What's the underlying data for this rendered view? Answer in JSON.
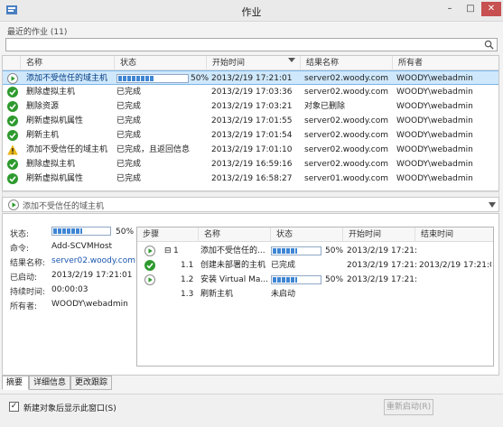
{
  "window": {
    "title": "作业",
    "min": "–",
    "max": "□",
    "close": "✕"
  },
  "recent_jobs": {
    "label": "最近的作业 (11)"
  },
  "search": {
    "placeholder": ""
  },
  "grid": {
    "columns": [
      "名称",
      "状态",
      "开始时间",
      "结果名称",
      "所有者"
    ],
    "rows": [
      {
        "icon": "running-play-icon",
        "name": "添加不受信任的域主机",
        "status": "",
        "progress": 50,
        "progress_label": "50%",
        "start": "2013/2/19 17:21:01",
        "result": "server02.woody.com",
        "owner": "WOODY\\webadmin",
        "selected": true
      },
      {
        "icon": "check-icon",
        "name": "删除虚拟主机",
        "status": "已完成",
        "start": "2013/2/19 17:03:36",
        "result": "server02.woody.com",
        "owner": "WOODY\\webadmin"
      },
      {
        "icon": "check-icon",
        "name": "删除资源",
        "status": "已完成",
        "start": "2013/2/19 17:03:21",
        "result": "对象已删除",
        "owner": "WOODY\\webadmin"
      },
      {
        "icon": "check-icon",
        "name": "刷新虚拟机属性",
        "status": "已完成",
        "start": "2013/2/19 17:01:55",
        "result": "server02.woody.com",
        "owner": "WOODY\\webadmin"
      },
      {
        "icon": "check-icon",
        "name": "刷新主机",
        "status": "已完成",
        "start": "2013/2/19 17:01:54",
        "result": "server02.woody.com",
        "owner": "WOODY\\webadmin"
      },
      {
        "icon": "warning-icon",
        "name": "添加不受信任的域主机",
        "status": "已完成，且返回信息",
        "start": "2013/2/19 17:01:10",
        "result": "server02.woody.com",
        "owner": "WOODY\\webadmin"
      },
      {
        "icon": "check-icon",
        "name": "删除虚拟主机",
        "status": "已完成",
        "start": "2013/2/19 16:59:16",
        "result": "server02.woody.com",
        "owner": "WOODY\\webadmin"
      },
      {
        "icon": "check-icon",
        "name": "刷新虚拟机属性",
        "status": "已完成",
        "start": "2013/2/19 16:58:27",
        "result": "server01.woody.com",
        "owner": "WOODY\\webadmin"
      }
    ]
  },
  "selected_job": {
    "title": "添加不受信任的域主机"
  },
  "details": {
    "status_label": "状态:",
    "status_progress": 50,
    "status_pct": "50%",
    "command_label": "命令:",
    "command": "Add-SCVMHost",
    "result_label": "结果名称:",
    "result": "server02.woody.com",
    "started_label": "已启动:",
    "started": "2013/2/19 17:21:01",
    "duration_label": "持续时间:",
    "duration": "00:00:03",
    "owner_label": "所有者:",
    "owner": "WOODY\\webadmin"
  },
  "steps": {
    "columns": [
      "步骤",
      "名称",
      "状态",
      "开始时间",
      "结束时间"
    ],
    "rows": [
      {
        "icon": "running-play-icon",
        "step": "1",
        "expand": "⊟",
        "name": "添加不受信任的...",
        "progress": 50,
        "pct": "50%",
        "start": "2013/2/19 17:21:01",
        "end": ""
      },
      {
        "icon": "check-icon",
        "step": "1.1",
        "name": "创建未部署的主机",
        "status": "已完成",
        "start": "2013/2/19 17:21:01",
        "end": "2013/2/19 17:21:01"
      },
      {
        "icon": "running-play-icon",
        "step": "1.2",
        "name": "安装 Virtual Ma...",
        "progress": 50,
        "pct": "50%",
        "start": "2013/2/19 17:21:02",
        "end": ""
      },
      {
        "icon": "",
        "step": "1.3",
        "name": "刷新主机",
        "status": "未启动",
        "start": "",
        "end": ""
      }
    ]
  },
  "tabs": [
    "摘要",
    "详细信息",
    "更改跟踪"
  ],
  "footer": {
    "checkbox_label": "新建对象后显示此窗口(S)",
    "checked": true,
    "restart_label": "重新启动(R)"
  },
  "colors": {
    "accent": "#3f86d4",
    "success": "#2e9a2e",
    "warning": "#e8b516",
    "selection": "#cfe8fc"
  }
}
